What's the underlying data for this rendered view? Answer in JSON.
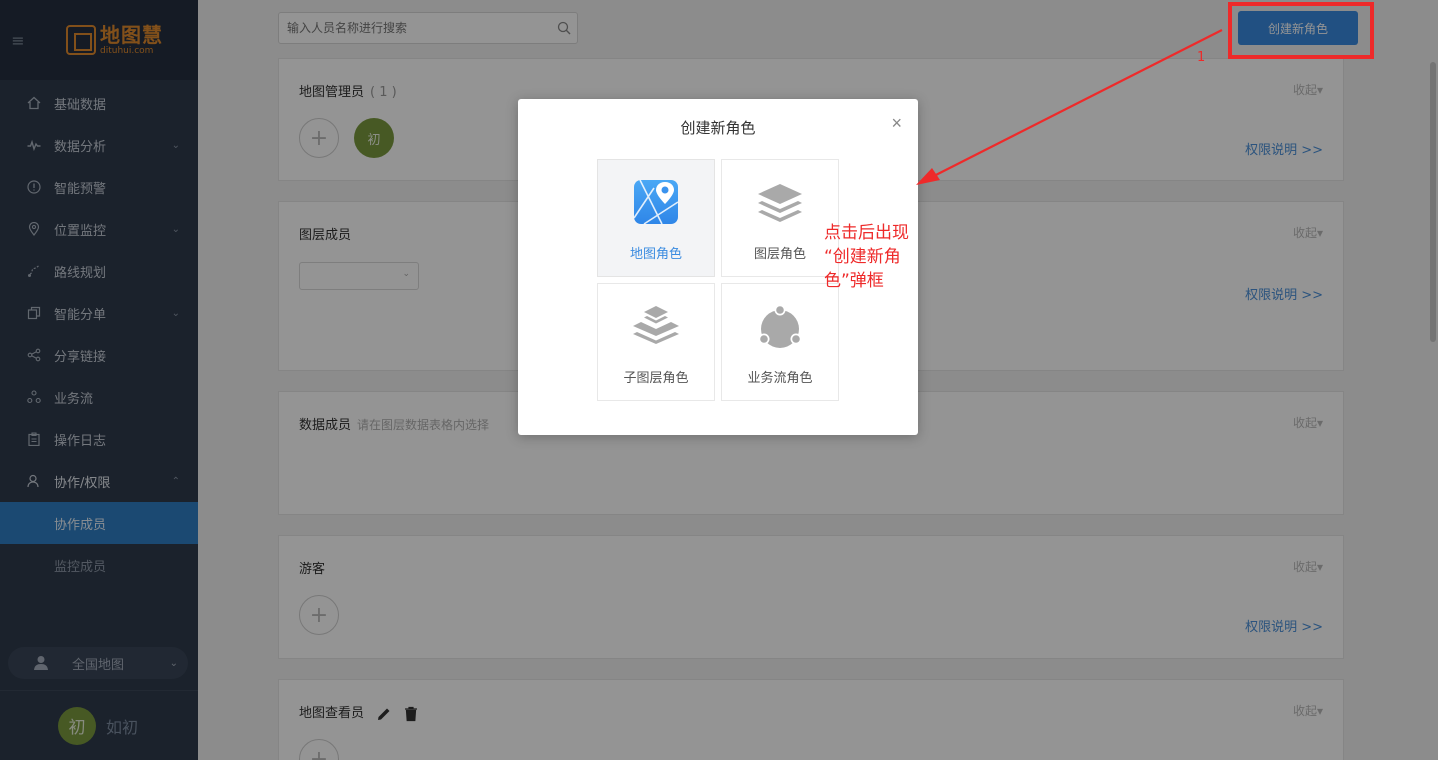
{
  "sidebar": {
    "logo_name": "地图慧",
    "logo_url": "dituhui.com",
    "items": [
      {
        "label": "基础数据",
        "icon": "home-icon"
      },
      {
        "label": "数据分析",
        "icon": "pulse-icon",
        "has_children": true
      },
      {
        "label": "智能预警",
        "icon": "alert-icon"
      },
      {
        "label": "位置监控",
        "icon": "location-pin-icon",
        "has_children": true
      },
      {
        "label": "路线规划",
        "icon": "route-icon"
      },
      {
        "label": "智能分单",
        "icon": "copy-icon",
        "has_children": true
      },
      {
        "label": "分享链接",
        "icon": "share-icon"
      },
      {
        "label": "业务流",
        "icon": "workflow-icon"
      },
      {
        "label": "操作日志",
        "icon": "clipboard-icon"
      },
      {
        "label": "协作/权限",
        "icon": "user-icon",
        "expanded": true
      }
    ],
    "sub_items": [
      {
        "label": "协作成员",
        "active": true
      },
      {
        "label": "监控成员",
        "active": false
      }
    ],
    "region": "全国地图",
    "user": {
      "avatar_text": "初",
      "name": "如初"
    }
  },
  "header": {
    "search_placeholder": "输入人员名称进行搜索",
    "create_button": "创建新角色",
    "highlight_number": "1"
  },
  "sections": [
    {
      "title": "地图管理员",
      "count": "( 1 )",
      "collapse": "收起",
      "link": "权限说明 >>",
      "member": "初"
    },
    {
      "title": "图层成员",
      "collapse": "收起",
      "link": "权限说明 >>"
    },
    {
      "title": "数据成员",
      "hint": "请在图层数据表格内选择",
      "collapse": "收起"
    },
    {
      "title": "游客",
      "collapse": "收起",
      "link": "权限说明 >>"
    },
    {
      "title": "地图查看员",
      "collapse": "收起"
    }
  ],
  "modal": {
    "title": "创建新角色",
    "close": "×",
    "roles": [
      {
        "label": "地图角色",
        "icon": "map-pin-icon",
        "selected": true
      },
      {
        "label": "图层角色",
        "icon": "layers-icon"
      },
      {
        "label": "子图层角色",
        "icon": "sublayers-icon"
      },
      {
        "label": "业务流角色",
        "icon": "workflow-icon"
      }
    ]
  },
  "annotation": {
    "line1": "点击后出现",
    "line2": "“创建新角",
    "line3": "色”弹框"
  },
  "colors": {
    "accent": "#3a8be0",
    "sidebar_bg": "#2f3b4c",
    "highlight_red": "#ee2a2a",
    "avatar_green": "#7a9a3f",
    "logo_orange": "#e08a2e"
  }
}
